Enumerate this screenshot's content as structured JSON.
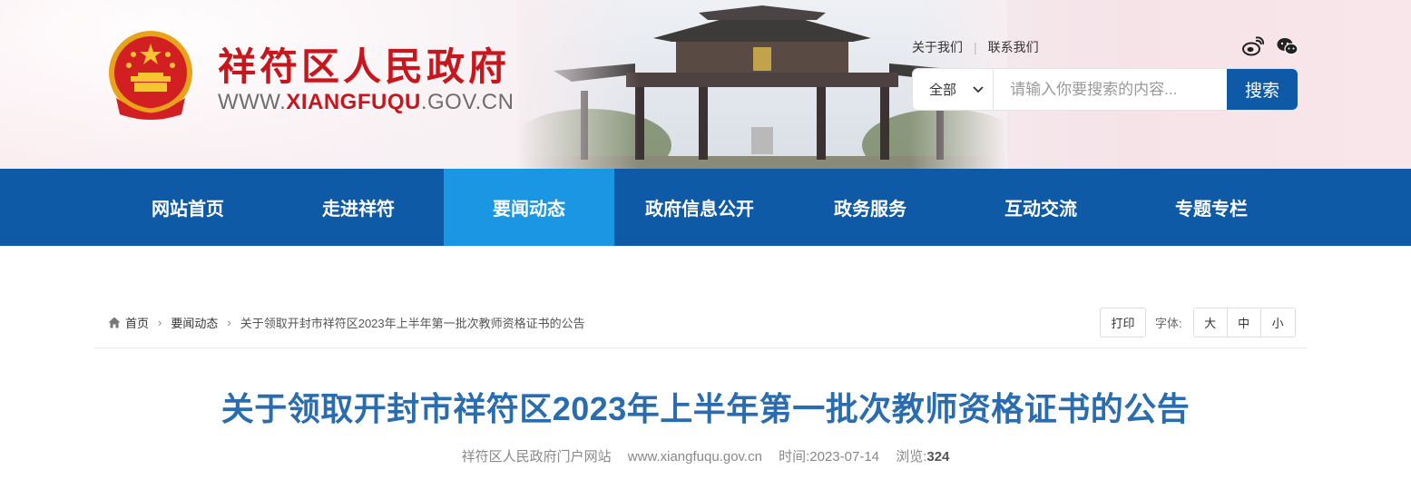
{
  "header": {
    "site_title": "祥符区人民政府",
    "site_url_prefix": "WWW.",
    "site_url_highlight": "XIANGFUQU",
    "site_url_suffix": ".GOV.CN",
    "top_links": [
      "关于我们",
      "联系我们"
    ],
    "social_icons": [
      "weibo-icon",
      "wechat-icon"
    ]
  },
  "search": {
    "scope_value": "全部",
    "placeholder": "请输入你要搜索的内容...",
    "button_label": "搜索"
  },
  "nav": {
    "items": [
      "网站首页",
      "走进祥符",
      "要闻动态",
      "政府信息公开",
      "政务服务",
      "互动交流",
      "专题专栏"
    ],
    "active_index": 2
  },
  "breadcrumb": {
    "home": "首页",
    "section": "要闻动态",
    "current": "关于领取开封市祥符区2023年上半年第一批次教师资格证书的公告"
  },
  "tools": {
    "print_label": "打印",
    "font_label": "字体:",
    "font_sizes": [
      "大",
      "中",
      "小"
    ]
  },
  "article": {
    "title": "关于领取开封市祥符区2023年上半年第一批次教师资格证书的公告",
    "source": "祥符区人民政府门户网站",
    "source_url": "www.xiangfuqu.gov.cn",
    "time_label": "时间:",
    "time_value": "2023-07-14",
    "views_label": "浏览:",
    "views_value": "324"
  },
  "colors": {
    "brand_red": "#c8161d",
    "nav_blue": "#0e5aa7",
    "nav_active": "#1a96e2",
    "title_blue": "#2a6cb0"
  }
}
